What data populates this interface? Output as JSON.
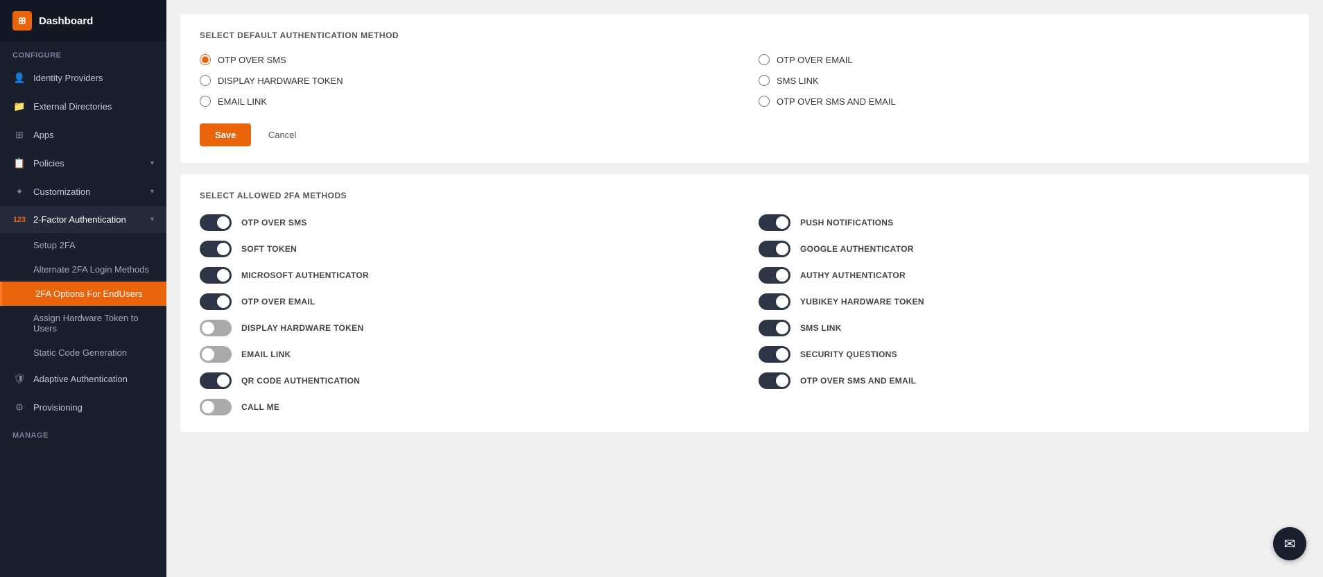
{
  "sidebar": {
    "app_icon": "123",
    "app_title": "Dashboard",
    "sections": [
      {
        "label": "Configure",
        "items": [
          {
            "id": "identity-providers",
            "label": "Identity Providers",
            "icon": "👤",
            "has_chevron": false
          },
          {
            "id": "external-directories",
            "label": "External Directories",
            "icon": "📁",
            "has_chevron": false
          },
          {
            "id": "apps",
            "label": "Apps",
            "icon": "⊞",
            "has_chevron": false
          },
          {
            "id": "policies",
            "label": "Policies",
            "icon": "📋",
            "has_chevron": true
          },
          {
            "id": "customization",
            "label": "Customization",
            "icon": "✦",
            "has_chevron": true
          },
          {
            "id": "2fa",
            "label": "2-Factor Authentication",
            "icon": "123",
            "has_chevron": true,
            "expanded": true,
            "sub_items": [
              {
                "id": "setup-2fa",
                "label": "Setup 2FA",
                "active": false
              },
              {
                "id": "alternate-2fa",
                "label": "Alternate 2FA Login Methods",
                "active": false
              },
              {
                "id": "2fa-options",
                "label": "2FA Options For EndUsers",
                "active": true
              },
              {
                "id": "assign-hardware",
                "label": "Assign Hardware Token to Users",
                "active": false
              },
              {
                "id": "static-code",
                "label": "Static Code Generation",
                "active": false
              }
            ]
          },
          {
            "id": "adaptive-auth",
            "label": "Adaptive Authentication",
            "icon": "🛡",
            "has_chevron": false
          },
          {
            "id": "provisioning",
            "label": "Provisioning",
            "icon": "⚙",
            "has_chevron": false
          }
        ]
      },
      {
        "label": "Manage",
        "items": []
      }
    ]
  },
  "main": {
    "section1": {
      "title": "SELECT DEFAULT AUTHENTICATION METHOD",
      "radio_options": [
        {
          "id": "otp-sms",
          "label": "OTP OVER SMS",
          "checked": true
        },
        {
          "id": "otp-email",
          "label": "OTP OVER EMAIL",
          "checked": false
        },
        {
          "id": "display-hw",
          "label": "DISPLAY HARDWARE TOKEN",
          "checked": false
        },
        {
          "id": "sms-link",
          "label": "SMS LINK",
          "checked": false
        },
        {
          "id": "email-link",
          "label": "EMAIL LINK",
          "checked": false
        },
        {
          "id": "otp-sms-email",
          "label": "OTP OVER SMS AND EMAIL",
          "checked": false
        }
      ],
      "save_label": "Save",
      "cancel_label": "Cancel"
    },
    "section2": {
      "title": "SELECT ALLOWED 2FA METHODS",
      "toggles": [
        {
          "id": "t-otp-sms",
          "label": "OTP OVER SMS",
          "on": true,
          "col": 0
        },
        {
          "id": "t-push",
          "label": "PUSH NOTIFICATIONS",
          "on": true,
          "col": 1
        },
        {
          "id": "t-soft",
          "label": "SOFT TOKEN",
          "on": true,
          "col": 0
        },
        {
          "id": "t-google",
          "label": "GOOGLE AUTHENTICATOR",
          "on": true,
          "col": 1
        },
        {
          "id": "t-ms",
          "label": "MICROSOFT AUTHENTICATOR",
          "on": true,
          "col": 0
        },
        {
          "id": "t-authy",
          "label": "AUTHY AUTHENTICATOR",
          "on": true,
          "col": 1
        },
        {
          "id": "t-otp-email",
          "label": "OTP OVER EMAIL",
          "on": true,
          "col": 0
        },
        {
          "id": "t-yubikey",
          "label": "YUBIKEY HARDWARE TOKEN",
          "on": true,
          "col": 1
        },
        {
          "id": "t-display-hw",
          "label": "DISPLAY HARDWARE TOKEN",
          "on": false,
          "col": 0
        },
        {
          "id": "t-sms-link",
          "label": "SMS LINK",
          "on": true,
          "col": 1
        },
        {
          "id": "t-email-link",
          "label": "EMAIL LINK",
          "on": false,
          "col": 0
        },
        {
          "id": "t-sec-q",
          "label": "SECURITY QUESTIONS",
          "on": true,
          "col": 1
        },
        {
          "id": "t-qr",
          "label": "QR CODE AUTHENTICATION",
          "on": true,
          "col": 0
        },
        {
          "id": "t-otp-sms-email",
          "label": "OTP OVER SMS AND EMAIL",
          "on": true,
          "col": 1
        },
        {
          "id": "t-call",
          "label": "CALL ME",
          "on": false,
          "col": 0
        }
      ]
    }
  },
  "chat": {
    "icon": "✉"
  }
}
